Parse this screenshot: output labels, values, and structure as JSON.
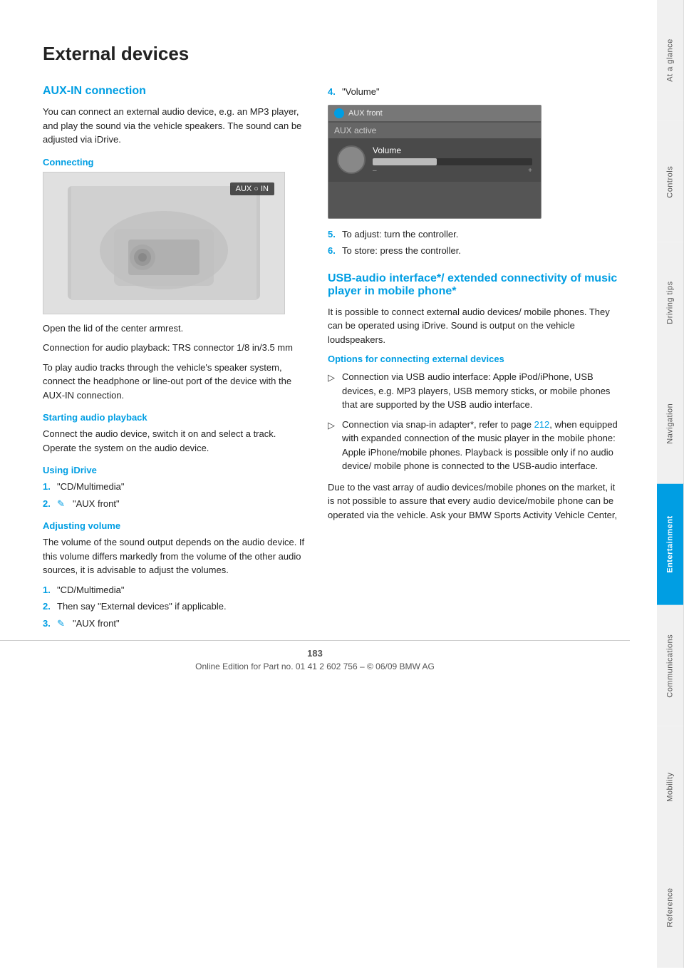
{
  "page": {
    "title": "External devices",
    "page_number": "183",
    "footer_text": "Online Edition for Part no. 01 41 2 602 756 – © 06/09 BMW AG"
  },
  "sidebar": {
    "tabs": [
      {
        "id": "at-a-glance",
        "label": "At a glance",
        "active": false
      },
      {
        "id": "controls",
        "label": "Controls",
        "active": false
      },
      {
        "id": "driving-tips",
        "label": "Driving tips",
        "active": false
      },
      {
        "id": "navigation",
        "label": "Navigation",
        "active": false
      },
      {
        "id": "entertainment",
        "label": "Entertainment",
        "active": true
      },
      {
        "id": "communications",
        "label": "Communications",
        "active": false
      },
      {
        "id": "mobility",
        "label": "Mobility",
        "active": false
      },
      {
        "id": "reference",
        "label": "Reference",
        "active": false
      }
    ]
  },
  "left_column": {
    "section_heading": "AUX-IN connection",
    "intro_text": "You can connect an external audio device, e.g. an MP3 player, and play the sound via the vehicle speakers. The sound can be adjusted via iDrive.",
    "connecting_heading": "Connecting",
    "image_badge": "AUX ○ IN",
    "image_caption_1": "Open the lid of the center armrest.",
    "image_caption_2": "Connection for audio playback: TRS connector 1/8 in/3.5 mm",
    "playback_text": "To play audio tracks through the vehicle's speaker system, connect the headphone or line-out port of the device with the AUX-IN connection.",
    "starting_heading": "Starting audio playback",
    "starting_text": "Connect the audio device, switch it on and select a track. Operate the system on the audio device.",
    "using_idrive_heading": "Using iDrive",
    "steps_idrive": [
      {
        "num": "1.",
        "text": "\"CD/Multimedia\""
      },
      {
        "num": "2.",
        "icon": "✎",
        "text": "\"AUX front\""
      }
    ],
    "adjusting_heading": "Adjusting volume",
    "adjusting_text": "The volume of the sound output depends on the audio device. If this volume differs markedly from the volume of the other audio sources, it is advisable to adjust the volumes.",
    "steps_volume": [
      {
        "num": "1.",
        "text": "\"CD/Multimedia\""
      },
      {
        "num": "2.",
        "text": "Then say \"External devices\" if applicable."
      },
      {
        "num": "3.",
        "icon": "✎",
        "text": "\"AUX front\""
      }
    ]
  },
  "right_column": {
    "step4_label": "4.",
    "step4_text": "\"Volume\"",
    "vol_screen": {
      "header": "AUX front",
      "aux_active": "AUX active",
      "vol_label": "Volume",
      "minus": "–",
      "plus": "+"
    },
    "step5_label": "5.",
    "step5_text": "To adjust: turn the controller.",
    "step6_label": "6.",
    "step6_text": "To store: press the controller.",
    "usb_heading": "USB-audio interface*/ extended connectivity of music player in mobile phone*",
    "usb_intro": "It is possible to connect external audio devices/ mobile phones. They can be operated using iDrive. Sound is output on the vehicle loudspeakers.",
    "options_heading": "Options for connecting external devices",
    "options_bullets": [
      {
        "icon": "▷",
        "text": "Connection via USB audio interface: Apple iPod/iPhone, USB devices, e.g. MP3 players, USB memory sticks, or mobile phones that are supported by the USB audio interface."
      },
      {
        "icon": "▷",
        "text": "Connection via snap-in adapter*, refer to page 212, when equipped with expanded connection of the music player in the mobile phone: Apple iPhone/mobile phones. Playback is possible only if no audio device/ mobile phone is connected to the USB-audio interface."
      }
    ],
    "due_text": "Due to the vast array of audio devices/mobile phones on the market, it is not possible to assure that every audio device/mobile phone can be operated via the vehicle. Ask your BMW Sports Activity Vehicle Center,",
    "page_ref": "212"
  }
}
